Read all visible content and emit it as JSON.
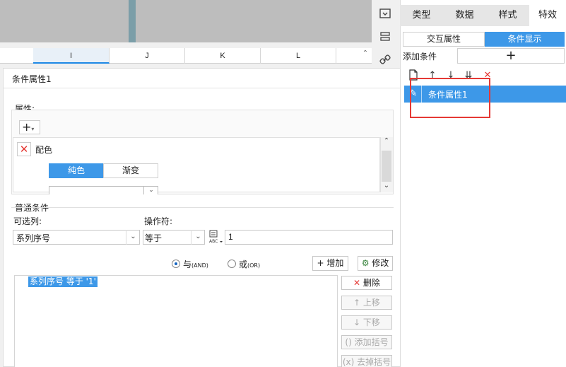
{
  "sheet": {
    "columns": [
      "I",
      "J",
      "K",
      "L"
    ]
  },
  "dialog": {
    "title": "条件属性1",
    "property_section_label": "属性:",
    "property_item_label": "配色",
    "color_tabs": [
      "纯色",
      "渐变"
    ],
    "normal_condition_label": "普通条件",
    "column_label": "可选列:",
    "operator_label": "操作符:",
    "column_value": "系列序号",
    "operator_value": "等于",
    "value_input": "1",
    "logic_and_label": "与",
    "logic_and_code": "(AND)",
    "logic_or_label": "或",
    "logic_or_code": "(OR)",
    "logic_selected": "and",
    "add_button": "增加",
    "modify_button": "修改",
    "condition_entry": "系列序号 等于 '1'",
    "side_buttons": {
      "delete": "删除",
      "move_up": "上移",
      "move_down": "下移",
      "add_paren": "添加括号",
      "remove_paren": "去掉括号"
    }
  },
  "right_panel": {
    "tabs": [
      "类型",
      "数据",
      "样式",
      "特效"
    ],
    "active_tab": "特效",
    "subtabs": [
      "交互属性",
      "条件显示"
    ],
    "active_subtab": "条件显示",
    "add_condition_label": "添加条件",
    "condition_items": [
      "条件属性1"
    ]
  },
  "colors": {
    "accent": "#3d98e8",
    "delete_red": "#e53935",
    "highlight_box": "#e53935"
  }
}
